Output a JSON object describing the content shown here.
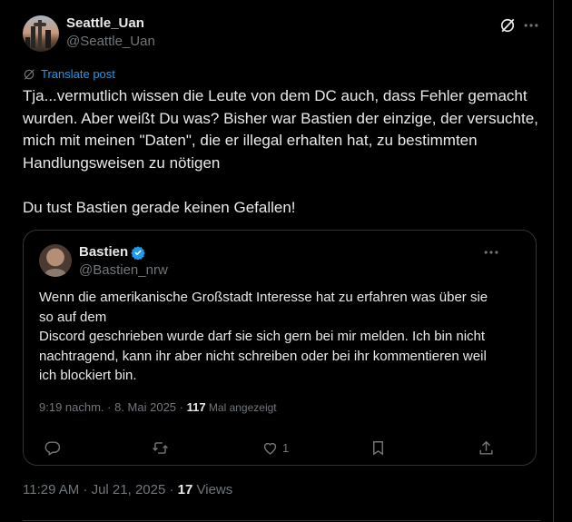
{
  "post": {
    "display_name": "Seattle_Uan",
    "handle": "@Seattle_Uan",
    "translate_label": "Translate post",
    "text": "Tja...vermutlich wissen die Leute von dem DC auch, dass Fehler gemacht wurden. Aber weißt Du was? Bisher war Bastien der einzige, der versuchte, mich mit meinen \"Daten\", die er illegal erhalten hat, zu bestimmten Handlungsweisen zu nötigen\n\nDu tust Bastien gerade keinen Gefallen!",
    "time": "11:29 AM · Jul 21, 2025 · ",
    "views_count": "17",
    "views_label": " Views"
  },
  "quote": {
    "display_name": "Bastien",
    "handle": "@Bastien_nrw",
    "text": "Wenn die amerikanische Großstadt Interesse hat zu erfahren was über sie so auf dem\nDiscord geschrieben wurde darf sie sich gern bei mir melden. Ich bin nicht nachtragend, kann ihr aber nicht schreiben oder bei ihr kommentieren weil ich blockiert bin.",
    "time": "9:19 nachm. · 8. Mai 2025 · ",
    "views_count": "117",
    "views_label": " Mal angezeigt",
    "like_count": "1"
  },
  "icons": {
    "grok": "grok-icon",
    "more": "more-horizontal-icon",
    "translate": "translate-icon",
    "verified": "verified-badge-icon",
    "reply": "reply-icon",
    "repost": "repost-icon",
    "like": "like-icon",
    "bookmark": "bookmark-icon",
    "share": "share-icon"
  },
  "colors": {
    "background": "#000000",
    "text": "#e7e9ea",
    "muted": "#71767b",
    "accent": "#1d9bf0",
    "border": "#2f3336"
  }
}
